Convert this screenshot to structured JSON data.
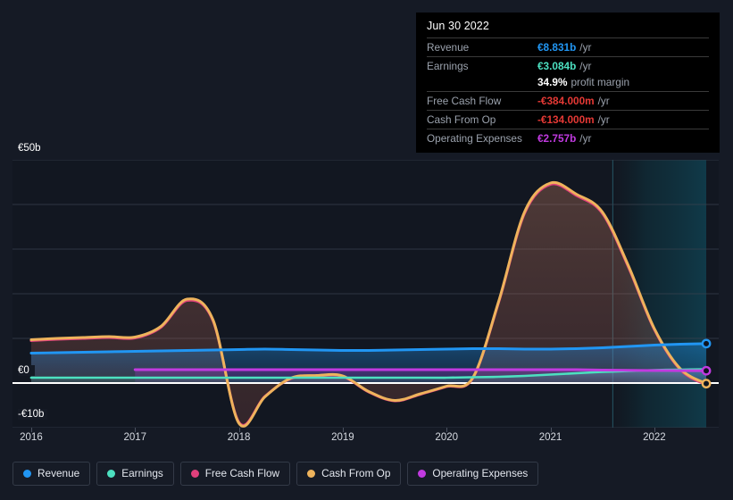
{
  "tooltip": {
    "date": "Jun 30 2022",
    "rows": [
      {
        "label": "Revenue",
        "value": "€8.831b",
        "unit": "/yr",
        "color": "#2196f3"
      },
      {
        "label": "Earnings",
        "value": "€3.084b",
        "unit": "/yr",
        "color": "#4ce0c0"
      },
      {
        "label": "",
        "value": "34.9%",
        "unit": "profit margin",
        "color": "#ffffff"
      },
      {
        "label": "Free Cash Flow",
        "value": "-€384.000m",
        "unit": "/yr",
        "color": "#e53935"
      },
      {
        "label": "Cash From Op",
        "value": "-€134.000m",
        "unit": "/yr",
        "color": "#e53935"
      },
      {
        "label": "Operating Expenses",
        "value": "€2.757b",
        "unit": "/yr",
        "color": "#c13ae0"
      }
    ]
  },
  "axes": {
    "y_labels": [
      {
        "text": "€50b"
      },
      {
        "text": "€0"
      },
      {
        "text": "-€10b"
      }
    ],
    "x_labels": [
      "2016",
      "2017",
      "2018",
      "2019",
      "2020",
      "2021",
      "2022"
    ]
  },
  "legend": {
    "items": [
      {
        "label": "Revenue",
        "color": "#2196f3"
      },
      {
        "label": "Earnings",
        "color": "#4ce0c0"
      },
      {
        "label": "Free Cash Flow",
        "color": "#e0407c"
      },
      {
        "label": "Cash From Op",
        "color": "#eeb35c"
      },
      {
        "label": "Operating Expenses",
        "color": "#c13ae0"
      }
    ]
  },
  "chart_data": {
    "type": "area",
    "title": "",
    "xlabel": "",
    "ylabel": "",
    "ylim": [
      -10,
      50
    ],
    "grid": true,
    "legend_position": "bottom",
    "x": [
      2016.0,
      2016.25,
      2016.5,
      2016.75,
      2017.0,
      2017.25,
      2017.5,
      2017.75,
      2018.0,
      2018.25,
      2018.5,
      2018.75,
      2019.0,
      2019.25,
      2019.5,
      2019.75,
      2020.0,
      2020.25,
      2020.5,
      2020.75,
      2021.0,
      2021.25,
      2021.5,
      2021.75,
      2022.0,
      2022.25,
      2022.5
    ],
    "series": [
      {
        "name": "Revenue",
        "color": "#2196f3",
        "values": [
          6.7,
          6.8,
          6.9,
          7.0,
          7.1,
          7.2,
          7.3,
          7.4,
          7.5,
          7.6,
          7.5,
          7.4,
          7.3,
          7.3,
          7.4,
          7.5,
          7.6,
          7.7,
          7.7,
          7.6,
          7.6,
          7.7,
          7.9,
          8.2,
          8.5,
          8.7,
          8.831
        ],
        "end_value_label": "€8.831b"
      },
      {
        "name": "Earnings",
        "color": "#4ce0c0",
        "values": [
          1.2,
          1.2,
          1.2,
          1.2,
          1.2,
          1.2,
          1.2,
          1.2,
          1.2,
          1.2,
          1.2,
          1.2,
          1.2,
          1.2,
          1.2,
          1.2,
          1.2,
          1.3,
          1.4,
          1.6,
          1.9,
          2.2,
          2.5,
          2.7,
          2.9,
          3.0,
          3.084
        ],
        "end_value_label": "€3.084b"
      },
      {
        "name": "Free Cash Flow",
        "color": "#e0407c",
        "values": [
          9.5,
          9.8,
          10.0,
          10.2,
          10.1,
          12.5,
          18.5,
          14.0,
          -8.8,
          -3.0,
          1.0,
          1.6,
          1.5,
          -2.0,
          -4.0,
          -2.5,
          -0.8,
          1.0,
          18.0,
          38.0,
          44.5,
          42.0,
          38.0,
          26.0,
          12.0,
          3.0,
          -0.384
        ],
        "end_value_label": "-€384.000m"
      },
      {
        "name": "Cash From Op",
        "color": "#eeb35c",
        "values": [
          9.7,
          10.0,
          10.2,
          10.4,
          10.3,
          12.7,
          18.8,
          14.2,
          -9.0,
          -3.1,
          1.1,
          1.7,
          1.6,
          -1.9,
          -3.9,
          -2.4,
          -0.7,
          1.1,
          18.2,
          38.3,
          44.8,
          42.3,
          38.3,
          26.3,
          12.2,
          3.2,
          -0.134
        ],
        "end_value_label": "-€134.000m"
      },
      {
        "name": "Operating Expenses",
        "color": "#c13ae0",
        "values": [
          null,
          null,
          null,
          null,
          3.0,
          3.0,
          3.0,
          3.0,
          3.0,
          3.0,
          3.0,
          3.0,
          3.0,
          3.0,
          3.0,
          3.0,
          3.0,
          3.0,
          3.0,
          3.0,
          3.0,
          3.0,
          2.9,
          2.85,
          2.8,
          2.78,
          2.757
        ],
        "end_value_label": "€2.757b"
      }
    ],
    "forecast_band": {
      "start_x": 2021.6,
      "end_x": 2022.5,
      "label": ""
    }
  }
}
